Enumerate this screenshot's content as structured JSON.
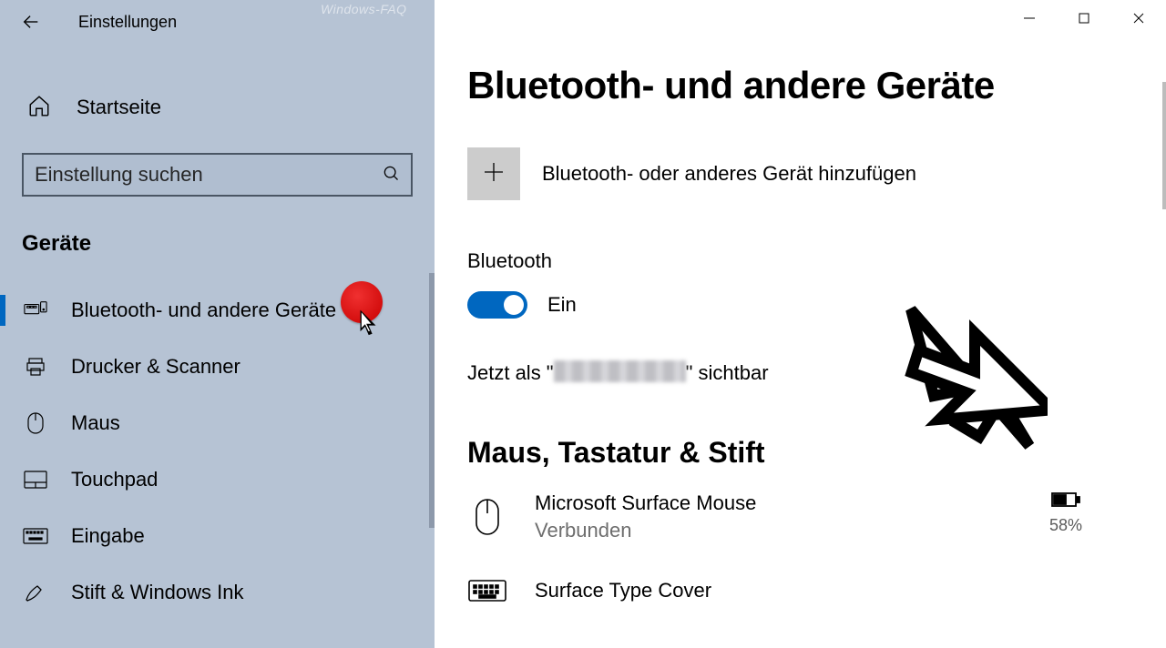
{
  "window": {
    "title": "Einstellungen",
    "watermark": "Windows-FAQ"
  },
  "sidebar": {
    "home": "Startseite",
    "search_placeholder": "Einstellung suchen",
    "section": "Geräte",
    "items": [
      {
        "label": "Bluetooth- und andere Geräte",
        "active": true
      },
      {
        "label": "Drucker & Scanner",
        "active": false
      },
      {
        "label": "Maus",
        "active": false
      },
      {
        "label": "Touchpad",
        "active": false
      },
      {
        "label": "Eingabe",
        "active": false
      },
      {
        "label": "Stift & Windows Ink",
        "active": false
      }
    ]
  },
  "main": {
    "title": "Bluetooth- und andere Geräte",
    "add_device": "Bluetooth- oder anderes Gerät hinzufügen",
    "bluetooth": {
      "header": "Bluetooth",
      "state_label": "Ein",
      "enabled": true,
      "visible_prefix": "Jetzt als \"",
      "visible_suffix": "\" sichtbar"
    },
    "category_mouse_kbd": "Maus, Tastatur & Stift",
    "devices": {
      "mouse": {
        "name": "Microsoft Surface Mouse",
        "status": "Verbunden",
        "battery_percent": "58%"
      },
      "keyboard": {
        "name": "Surface Type Cover"
      }
    }
  }
}
